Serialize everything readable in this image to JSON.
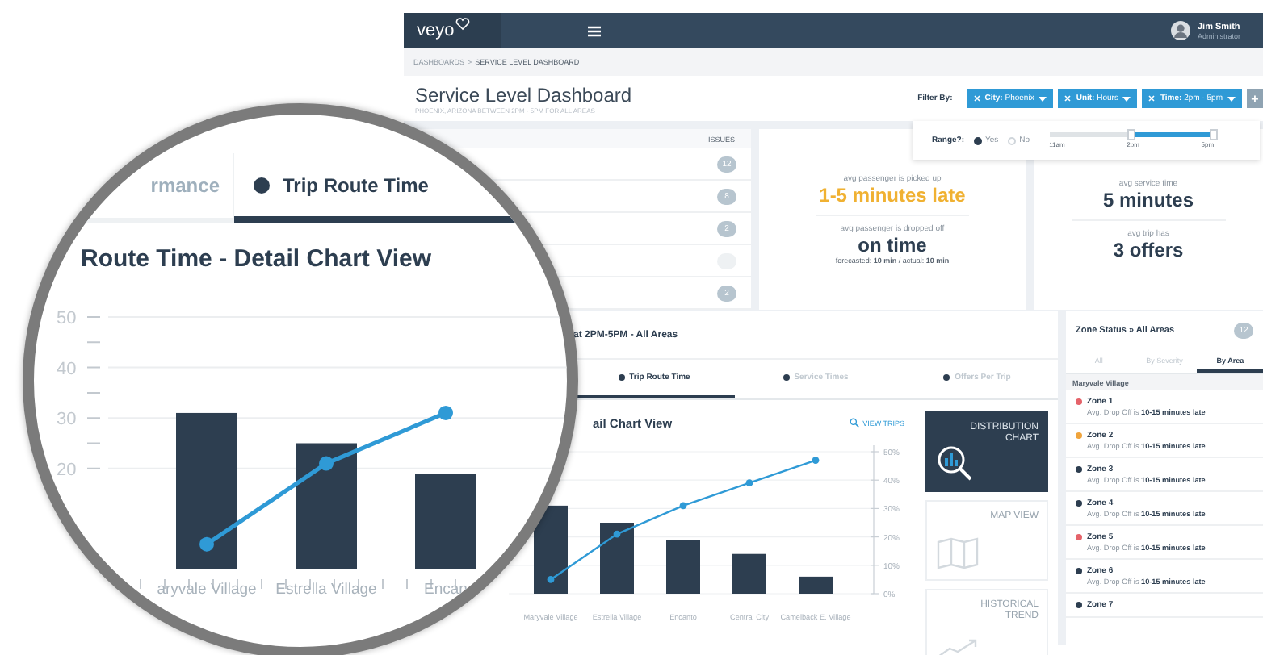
{
  "topbar": {
    "logo": "veyo",
    "user": {
      "name": "Jim Smith",
      "role": "Administrator"
    }
  },
  "breadcrumb": {
    "items": [
      {
        "label": "DASHBOARDS",
        "current": false
      },
      {
        "label": "SERVICE LEVEL DASHBOARD",
        "current": true
      }
    ],
    "separator": ">"
  },
  "header": {
    "title": "Service Level Dashboard",
    "subtitle": "PHOENIX, ARIZONA BETWEEN 2PM - 5PM FOR ALL AREAS",
    "filter_label": "Filter By:",
    "filters": [
      "**City:** Phoenix",
      "**Unit:** Hours",
      "**Time:** 2pm - 5pm"
    ],
    "add_button": "+"
  },
  "range_popup": {
    "label": "Range?:",
    "options": [
      {
        "label": "Yes",
        "selected": true
      },
      {
        "label": "No",
        "selected": false
      }
    ],
    "slider": {
      "level": 0.5,
      "labels": [
        "11am",
        "2pm",
        "5pm"
      ]
    }
  },
  "issues_table": {
    "column": "ISSUES",
    "rows": [
      {
        "kind": "count",
        "issues": "12"
      },
      {
        "kind": "count",
        "issues": "8"
      },
      {
        "kind": "count",
        "issues": "2"
      },
      {
        "kind": "empty"
      },
      {
        "kind": "count",
        "issues": "2"
      }
    ]
  },
  "stat_cards": [
    {
      "stats": [
        {
          "caption": "avg passenger is picked up",
          "value": "1-5 minutes late",
          "color": "#f0b132"
        },
        {
          "caption": "avg passenger is dropped off",
          "value": "on time",
          "color": "#2d3e50",
          "note": "forecasted: **10 min** / actual: **10 min**"
        }
      ]
    },
    {
      "stats": [
        {
          "caption": "avg service time",
          "value": "5 minutes",
          "color": "#2d3e50"
        },
        {
          "caption": "avg trip has",
          "value": "3 offers",
          "color": "#2d3e50"
        }
      ]
    }
  ],
  "trip_panel": {
    "title": "at 2PM-5PM - All Areas",
    "tabs": [
      {
        "label": "Trip Route Time",
        "selected": true
      },
      {
        "label": "Service Times",
        "selected": false
      },
      {
        "label": "Offers Per Trip",
        "selected": false
      }
    ],
    "chart_title": "ail Chart View",
    "view_trips": "VIEW TRIPS",
    "chart_data": {
      "type": "bar",
      "categories": [
        "Maryvale Village",
        "Estrella Village",
        "Encanto",
        "Central City",
        "Camelback E. Village"
      ],
      "series": [
        {
          "type": "bar",
          "color": "#2d3e50",
          "values": [
            31,
            25,
            19,
            14,
            6
          ]
        },
        {
          "type": "line",
          "color": "#2f9ad6",
          "values": [
            5,
            21,
            31,
            39,
            47
          ],
          "marker": true
        }
      ],
      "ylim": [
        0,
        50
      ],
      "grid": true,
      "yticks": [
        {
          "value": 0,
          "label": "0%"
        },
        {
          "value": 10,
          "label": "10%"
        },
        {
          "value": 20,
          "label": "20%"
        },
        {
          "value": 30,
          "label": "30%"
        },
        {
          "value": 40,
          "label": "40%"
        },
        {
          "value": 50,
          "label": "50%"
        }
      ]
    },
    "views": [
      {
        "kind": "distribution",
        "label": "DISTRIBUTION CHART",
        "selected": true
      },
      {
        "kind": "map",
        "label": "MAP VIEW",
        "selected": false
      },
      {
        "kind": "trend",
        "label": "HISTORICAL TREND",
        "selected": false
      }
    ]
  },
  "zone_panel": {
    "title": "Zone Status » All Areas",
    "count": "12",
    "tabs": [
      {
        "label": "All",
        "selected": false
      },
      {
        "label": "By Severity",
        "selected": false
      },
      {
        "label": "By Area",
        "selected": true
      }
    ],
    "group": "Maryvale Village",
    "zones": [
      {
        "name": "Zone 1",
        "color": "#e5636a",
        "detail": "Avg. Drop Off is **10-15 minutes late**"
      },
      {
        "name": "Zone 2",
        "color": "#f0a43c",
        "detail": "Avg. Drop Off is **10-15 minutes late**"
      },
      {
        "name": "Zone 3",
        "color": "#2d3e50",
        "detail": "Avg. Drop Off is **10-15 minutes late**"
      },
      {
        "name": "Zone 4",
        "color": "#2d3e50",
        "detail": "Avg. Drop Off is **10-15 minutes late**"
      },
      {
        "name": "Zone 5",
        "color": "#e5636a",
        "detail": "Avg. Drop Off is **10-15 minutes late**"
      },
      {
        "name": "Zone 6",
        "color": "#2d3e50",
        "detail": "Avg. Drop Off is **10-15 minutes late**"
      },
      {
        "name": "Zone 7",
        "color": "#2d3e50"
      }
    ]
  },
  "magnifier": {
    "tabs": [
      {
        "label": "rmance",
        "selected": false
      },
      {
        "label": "Trip Route Time",
        "selected": true
      }
    ],
    "title": "Route Time - Detail Chart View",
    "chart_data": {
      "type": "bar",
      "categories": [
        "aryvale Village",
        "Estrella Village",
        "Encan"
      ],
      "series": [
        {
          "type": "bar",
          "color": "#2d3e50",
          "values": [
            31,
            25,
            19
          ]
        },
        {
          "type": "line",
          "color": "#2f9ad6",
          "values": [
            5,
            21,
            31
          ],
          "marker": true
        }
      ],
      "ylim": [
        0,
        50
      ],
      "grid": true,
      "yticks": [
        20,
        30,
        40,
        50
      ]
    }
  }
}
